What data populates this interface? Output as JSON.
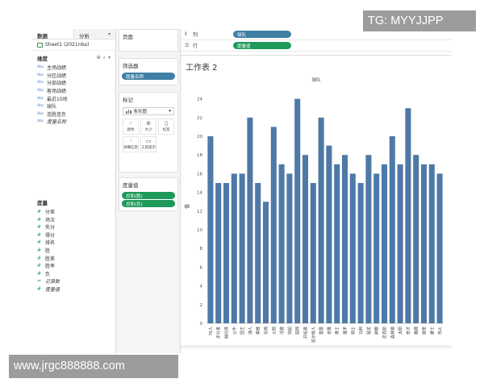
{
  "data_pane": {
    "tab_data": "数据",
    "tab_analysis": "分析",
    "datasource": "Sheet1 (2021nba)",
    "dimensions_header": "维度",
    "dimensions": [
      "主场战绩",
      "分区战绩",
      "分部战绩",
      "客场战绩",
      "最近10场",
      "球队",
      "连胜连负",
      "度量名称"
    ],
    "measures_header": "度量",
    "measures": [
      "分差",
      "场次",
      "失分",
      "得分",
      "排名",
      "胜",
      "胜差",
      "胜率",
      "负",
      "记录数",
      "度量值"
    ]
  },
  "pages_card": {
    "title": "页面"
  },
  "filters_card": {
    "title": "筛选器",
    "pill": "度量名称"
  },
  "marks_card": {
    "title": "标记",
    "mark_type": "条形图",
    "buttons": [
      "颜色",
      "大小",
      "标签",
      "详细信息",
      "工具提示"
    ]
  },
  "measure_values_card": {
    "title": "度量值",
    "pills": [
      "总和(胜)",
      "总和(负)"
    ]
  },
  "shelves": {
    "columns_label": "列",
    "columns_pill": "球队",
    "rows_label": "行",
    "rows_pill": "度量值"
  },
  "sheet": {
    "title": "工作表 2"
  },
  "chart_data": {
    "type": "bar",
    "title": "球队",
    "ylabel": "值",
    "xlabel": "",
    "ylim": [
      0,
      25
    ],
    "yticks": [
      0,
      2,
      4,
      6,
      8,
      10,
      12,
      14,
      16,
      18,
      20,
      22,
      24
    ],
    "grid": false,
    "bar_color": "#4e79a7",
    "categories": [
      "76人",
      "步行者",
      "独行侠",
      "公牛",
      "国王",
      "湖人",
      "黄蜂",
      "灰熊",
      "火箭",
      "活塞",
      "快船",
      "篮网",
      "开拓者",
      "凯尔特人",
      "雷霆",
      "老鹰",
      "勇士",
      "魔术",
      "骑士",
      "马刺",
      "猛龙",
      "鹈鹕",
      "尼克斯",
      "森林狼",
      "太阳",
      "奇才",
      "雄鹿",
      "掘金",
      "爵士",
      "热火"
    ],
    "values": [
      20,
      15,
      15,
      16,
      16,
      22,
      15,
      13,
      21,
      17,
      16,
      24,
      18,
      15,
      22,
      19,
      17,
      18,
      16,
      15,
      18,
      16,
      17,
      20,
      17,
      23,
      18,
      17,
      17,
      16
    ]
  },
  "watermarks": {
    "top": "TG: MYYJJPP",
    "bottom": "www.jrgc888888.com"
  }
}
